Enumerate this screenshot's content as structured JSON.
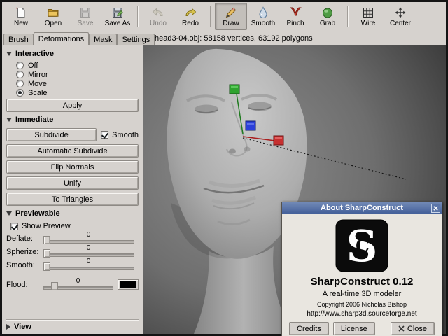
{
  "toolbar": {
    "items": [
      {
        "label": "New",
        "icon": "new-document-icon",
        "state": "normal"
      },
      {
        "label": "Open",
        "icon": "open-folder-icon",
        "state": "normal"
      },
      {
        "label": "Save",
        "icon": "save-floppy-icon",
        "state": "disabled"
      },
      {
        "label": "Save As",
        "icon": "save-as-floppy-icon",
        "state": "normal"
      },
      {
        "label": "Undo",
        "icon": "undo-arrow-icon",
        "state": "disabled"
      },
      {
        "label": "Redo",
        "icon": "redo-arrow-icon",
        "state": "normal"
      },
      {
        "label": "Draw",
        "icon": "pencil-icon",
        "state": "active"
      },
      {
        "label": "Smooth",
        "icon": "droplet-icon",
        "state": "normal"
      },
      {
        "label": "Pinch",
        "icon": "pinch-tongs-icon",
        "state": "normal"
      },
      {
        "label": "Grab",
        "icon": "grab-sphere-icon",
        "state": "normal"
      },
      {
        "label": "Wire",
        "icon": "wireframe-grid-icon",
        "state": "normal"
      },
      {
        "label": "Center",
        "icon": "center-arrows-icon",
        "state": "normal"
      }
    ]
  },
  "tabs": {
    "items": [
      {
        "label": "Brush",
        "active": false
      },
      {
        "label": "Deformations",
        "active": true
      },
      {
        "label": "Mask",
        "active": false
      },
      {
        "label": "Settings",
        "active": false
      }
    ]
  },
  "statusbar": {
    "text": "head3-04.obj: 58158 vertices, 63192 polygons"
  },
  "panel": {
    "interactive": {
      "header": "Interactive",
      "options": [
        {
          "label": "Off",
          "selected": false
        },
        {
          "label": "Mirror",
          "selected": false
        },
        {
          "label": "Move",
          "selected": false
        },
        {
          "label": "Scale",
          "selected": true
        }
      ],
      "apply_label": "Apply"
    },
    "immediate": {
      "header": "Immediate",
      "subdivide_label": "Subdivide",
      "smooth_checkbox": {
        "label": "Smooth",
        "checked": true
      },
      "buttons": [
        "Automatic Subdivide",
        "Flip Normals",
        "Unify",
        "To Triangles"
      ]
    },
    "previewable": {
      "header": "Previewable",
      "show_preview": {
        "label": "Show Preview",
        "checked": true
      },
      "sliders": [
        {
          "label": "Deflate:",
          "value": "0"
        },
        {
          "label": "Spherize:",
          "value": "0"
        },
        {
          "label": "Smooth:",
          "value": "0"
        }
      ],
      "flood": {
        "label": "Flood:",
        "value": "0",
        "swatch_color": "#000000"
      }
    },
    "view": {
      "header": "View"
    }
  },
  "dialog": {
    "title": "About SharpConstruct",
    "app_name": "SharpConstruct 0.12",
    "subtitle": "A real-time 3D modeler",
    "copyright": "Copyright 2006 Nicholas Bishop",
    "url": "http://www.sharp3d.sourceforge.net",
    "buttons": {
      "credits": "Credits",
      "license": "License",
      "close": "Close"
    }
  },
  "colors": {
    "titlebar_blue": "#44609a",
    "panel_bg": "#d6d2ce",
    "manipulator_green": "#2fa32f",
    "manipulator_blue": "#2b3fd9",
    "manipulator_red": "#c62f2f"
  }
}
